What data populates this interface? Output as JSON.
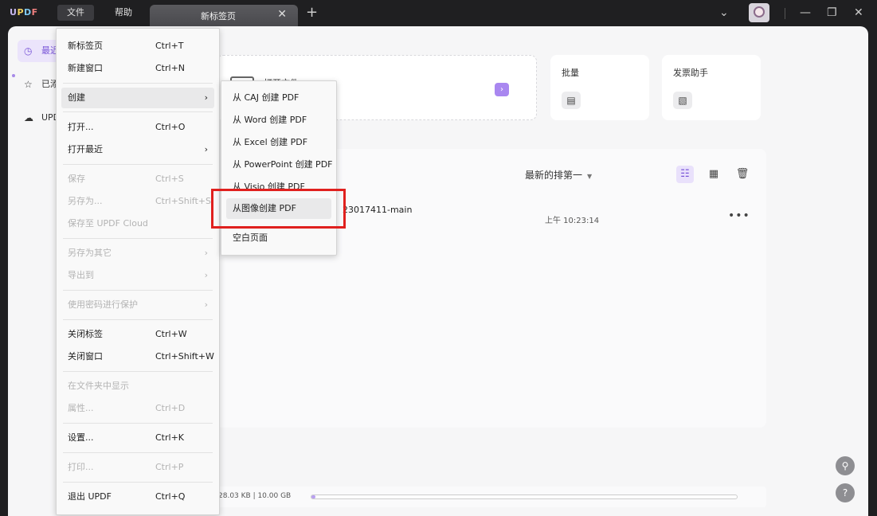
{
  "app": {
    "logo": {
      "u": "U",
      "p": "P",
      "d": "D",
      "f": "F"
    },
    "menu_file": "文件",
    "menu_help": "帮助"
  },
  "tab": {
    "label": "新标签页",
    "close": "✕",
    "new": "+"
  },
  "window": {
    "dropdown": "⌄",
    "minimize": "—",
    "restore": "❐",
    "close": "✕"
  },
  "sidebar": {
    "items": [
      {
        "label": "最近",
        "icon": "clock-icon",
        "glyph": "◷"
      },
      {
        "label": "已添",
        "icon": "star-icon",
        "glyph": "☆"
      },
      {
        "label": "UPD",
        "icon": "cloud-icon",
        "glyph": "☁"
      }
    ]
  },
  "cards": {
    "open_title": "打开文件",
    "open_arrow": "›",
    "batch_title": "批量",
    "batch_icon": "▤",
    "invoice_title": "发票助手",
    "invoice_icon": "▧"
  },
  "list": {
    "sort_label": "最新的排第一",
    "sort_caret": "▼",
    "views": [
      "☷",
      "▦",
      "🗑"
    ],
    "file_name": "23017411-main",
    "file_time": "上午 10:23:14",
    "file_more": "•••"
  },
  "footer": {
    "storage": "28.03 KB | 10.00 GB",
    "storage_fraction": 0.003
  },
  "help_buttons": {
    "search": "⚲",
    "help": "?"
  },
  "file_menu": {
    "items": [
      {
        "label": "新标签页",
        "shortcut": "Ctrl+T"
      },
      {
        "label": "新建窗口",
        "shortcut": "Ctrl+N"
      },
      {
        "label": "创建",
        "arrow": "›"
      },
      {
        "label": "打开...",
        "shortcut": "Ctrl+O"
      },
      {
        "label": "打开最近",
        "arrow": "›"
      },
      {
        "label": "保存",
        "shortcut": "Ctrl+S"
      },
      {
        "label": "另存为...",
        "shortcut": "Ctrl+Shift+S"
      },
      {
        "label": "保存至 UPDF Cloud"
      },
      {
        "label": "另存为其它",
        "arrow": "›"
      },
      {
        "label": "导出到",
        "arrow": "›"
      },
      {
        "label": "使用密码进行保护",
        "arrow": "›"
      },
      {
        "label": "关闭标签",
        "shortcut": "Ctrl+W"
      },
      {
        "label": "关闭窗口",
        "shortcut": "Ctrl+Shift+W"
      },
      {
        "label": "在文件夹中显示"
      },
      {
        "label": "属性...",
        "shortcut": "Ctrl+D"
      },
      {
        "label": "设置...",
        "shortcut": "Ctrl+K"
      },
      {
        "label": "打印...",
        "shortcut": "Ctrl+P"
      },
      {
        "label": "退出 UPDF",
        "shortcut": "Ctrl+Q"
      }
    ]
  },
  "create_menu": {
    "items": [
      "从 CAJ 创建 PDF",
      "从 Word 创建 PDF",
      "从 Excel 创建 PDF",
      "从 PowerPoint 创建 PDF",
      "从 Visio 创建 PDF",
      "从图像创建 PDF",
      "空白页面"
    ]
  }
}
